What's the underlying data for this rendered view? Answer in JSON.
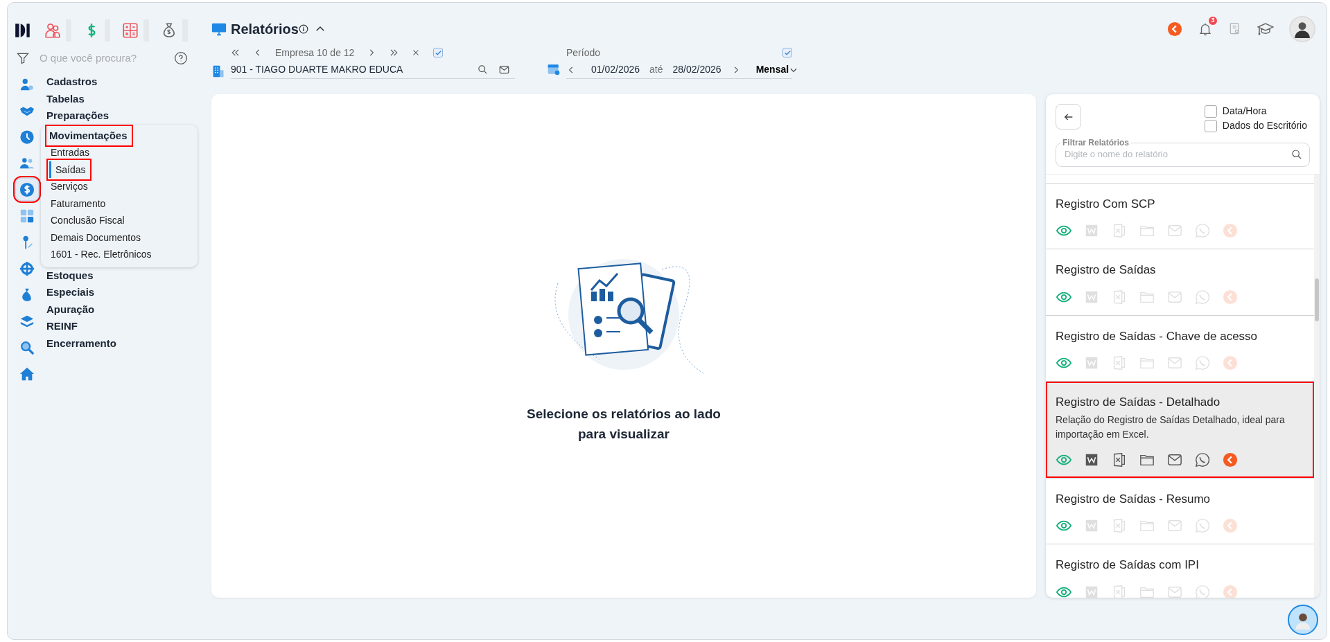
{
  "sidebar": {
    "search_placeholder": "O que você procura?",
    "rail": [
      {
        "kind": "user-gear",
        "selected": false,
        "highlighted": false
      },
      {
        "kind": "handshake",
        "selected": false,
        "highlighted": false
      },
      {
        "kind": "clock",
        "selected": false,
        "highlighted": false
      },
      {
        "kind": "people",
        "selected": false,
        "highlighted": false
      },
      {
        "kind": "dollar",
        "selected": true,
        "highlighted": true
      },
      {
        "kind": "calculator",
        "selected": false,
        "highlighted": false
      },
      {
        "kind": "pin",
        "selected": false,
        "highlighted": false
      },
      {
        "kind": "gear",
        "selected": false,
        "highlighted": false
      },
      {
        "kind": "bag",
        "selected": false,
        "highlighted": false
      },
      {
        "kind": "layers",
        "selected": false,
        "highlighted": false
      },
      {
        "kind": "search",
        "selected": false,
        "highlighted": false
      },
      {
        "kind": "home",
        "selected": false,
        "highlighted": false
      }
    ],
    "menu": [
      {
        "label": "Cadastros",
        "expanded": false,
        "highlighted": false
      },
      {
        "label": "Tabelas",
        "expanded": false,
        "highlighted": false
      },
      {
        "label": "Preparações",
        "expanded": false,
        "highlighted": false
      },
      {
        "label": "Movimentações",
        "expanded": true,
        "highlighted": true,
        "children": [
          {
            "label": "Entradas",
            "selected": false,
            "highlighted": false
          },
          {
            "label": "Saídas",
            "selected": true,
            "highlighted": true
          },
          {
            "label": "Serviços",
            "selected": false,
            "highlighted": false
          },
          {
            "label": "Faturamento",
            "selected": false,
            "highlighted": false
          },
          {
            "label": "Conclusão Fiscal",
            "selected": false,
            "highlighted": false
          },
          {
            "label": "Demais Documentos",
            "selected": false,
            "highlighted": false
          },
          {
            "label": "1601 - Rec. Eletrônicos",
            "selected": false,
            "highlighted": false
          }
        ]
      },
      {
        "label": "Estoques",
        "expanded": false,
        "highlighted": false
      },
      {
        "label": "Especiais",
        "expanded": false,
        "highlighted": false
      },
      {
        "label": "Apuração",
        "expanded": false,
        "highlighted": false
      },
      {
        "label": "REINF",
        "expanded": false,
        "highlighted": false
      },
      {
        "label": "Encerramento",
        "expanded": false,
        "highlighted": false
      }
    ]
  },
  "header": {
    "title": "Relatórios",
    "notification_count": "3",
    "company_nav": {
      "label": "Empresa 10 de 12",
      "checked": true
    },
    "company": "901 - TIAGO DUARTE MAKRO EDUCA",
    "period": {
      "label": "Período",
      "checked": true,
      "start": "01/02/2026",
      "separator": "até",
      "end": "28/02/2026",
      "mode": "Mensal"
    }
  },
  "main": {
    "message": "Selecione os relatórios ao lado para visualizar"
  },
  "reports_panel": {
    "options": [
      {
        "label": "Data/Hora",
        "checked": false
      },
      {
        "label": "Dados do Escritório",
        "checked": false
      }
    ],
    "filter": {
      "label": "Filtrar Relatórios",
      "placeholder": "Digite o nome do relatório"
    },
    "items": [
      {
        "title": "Registro Com SCP",
        "selected": false,
        "highlighted": false
      },
      {
        "title": "Registro de Saídas",
        "selected": false,
        "highlighted": false
      },
      {
        "title": "Registro de Saídas - Chave de acesso",
        "selected": false,
        "highlighted": false
      },
      {
        "title": "Registro de Saídas - Detalhado",
        "description": "Relação do Registro de Saídas Detalhado, ideal para importação em Excel.",
        "selected": true,
        "highlighted": true
      },
      {
        "title": "Registro de Saídas - Resumo",
        "selected": false,
        "highlighted": false
      },
      {
        "title": "Registro de Saídas com IPI",
        "selected": false,
        "highlighted": false
      }
    ]
  }
}
